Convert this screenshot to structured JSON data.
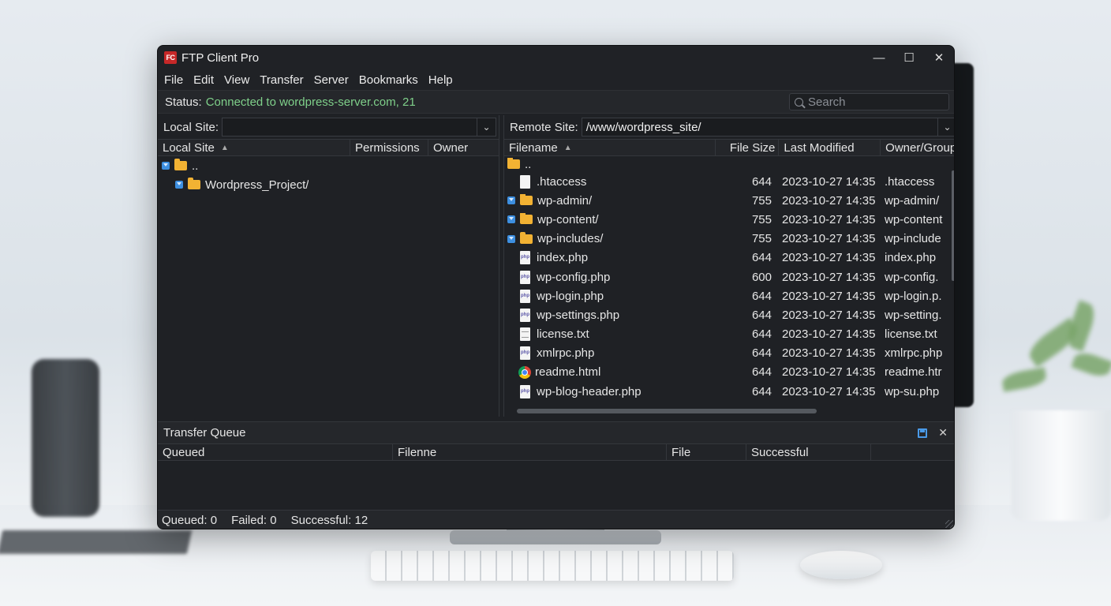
{
  "window": {
    "title": "FTP Client Pro",
    "logo_text": "FC"
  },
  "window_controls": {
    "minimize": "—",
    "maximize": "☐",
    "close": "✕"
  },
  "menu": [
    "File",
    "Edit",
    "View",
    "Transfer",
    "Server",
    "Bookmarks",
    "Help"
  ],
  "status": {
    "label": "Status:",
    "text": "Connected to wordpress-server.com, 21",
    "color": "#7fd08a"
  },
  "search": {
    "placeholder": "Search"
  },
  "local": {
    "site_label": "Local Site:",
    "site_value": "",
    "columns": [
      "Local Site",
      "Permissions",
      "Owner"
    ],
    "tree": [
      {
        "name": "..",
        "level": 0
      },
      {
        "name": "Wordpress_Project/",
        "level": 1
      }
    ]
  },
  "remote": {
    "site_label": "Remote Site:",
    "site_value": "/www/wordpress_site/",
    "columns": [
      "Filename",
      "File Size",
      "Last Modified",
      "Owner/Group"
    ],
    "parent": "..",
    "files": [
      {
        "name": ".htaccess",
        "size": "644",
        "modified": "2023-10-27 14:35",
        "owner": ".htaccess",
        "icon": "file-icon",
        "expandable": false
      },
      {
        "name": "wp-admin/",
        "size": "755",
        "modified": "2023-10-27 14:35",
        "owner": "wp-admin/",
        "icon": "folder-icon",
        "expandable": true
      },
      {
        "name": "wp-content/",
        "size": "755",
        "modified": "2023-10-27 14:35",
        "owner": "wp-content",
        "icon": "folder-icon",
        "expandable": true
      },
      {
        "name": "wp-includes/",
        "size": "755",
        "modified": "2023-10-27 14:35",
        "owner": "wp-include",
        "icon": "folder-icon",
        "expandable": true
      },
      {
        "name": "index.php",
        "size": "644",
        "modified": "2023-10-27 14:35",
        "owner": "index.php",
        "icon": "php-file-icon",
        "expandable": false
      },
      {
        "name": "wp-config.php",
        "size": "600",
        "modified": "2023-10-27 14:35",
        "owner": "wp-config.",
        "icon": "php-file-icon",
        "expandable": false
      },
      {
        "name": "wp-login.php",
        "size": "644",
        "modified": "2023-10-27 14:35",
        "owner": "wp-login.p.",
        "icon": "php-file-icon",
        "expandable": false
      },
      {
        "name": "wp-settings.php",
        "size": "644",
        "modified": "2023-10-27 14:35",
        "owner": "wp-setting.",
        "icon": "php-file-icon",
        "expandable": false
      },
      {
        "name": "license.txt",
        "size": "644",
        "modified": "2023-10-27 14:35",
        "owner": "license.txt",
        "icon": "text-file-icon",
        "expandable": false
      },
      {
        "name": "xmlrpc.php",
        "size": "644",
        "modified": "2023-10-27 14:35",
        "owner": "xmlrpc.php",
        "icon": "php-file-icon",
        "expandable": false
      },
      {
        "name": "readme.html",
        "size": "644",
        "modified": "2023-10-27 14:35",
        "owner": "readme.htr",
        "icon": "chrome-icon",
        "expandable": false
      },
      {
        "name": "wp-blog-header.php",
        "size": "644",
        "modified": "2023-10-27 14:35",
        "owner": "wp-su.php",
        "icon": "php-file-icon",
        "expandable": false
      }
    ]
  },
  "queue": {
    "title": "Transfer Queue",
    "columns": [
      "Queued",
      "Filenne",
      "File",
      "Successful"
    ]
  },
  "statusbar": {
    "queued": "Queued: 0",
    "failed": "Failed: 0",
    "successful": "Successful: 12"
  }
}
